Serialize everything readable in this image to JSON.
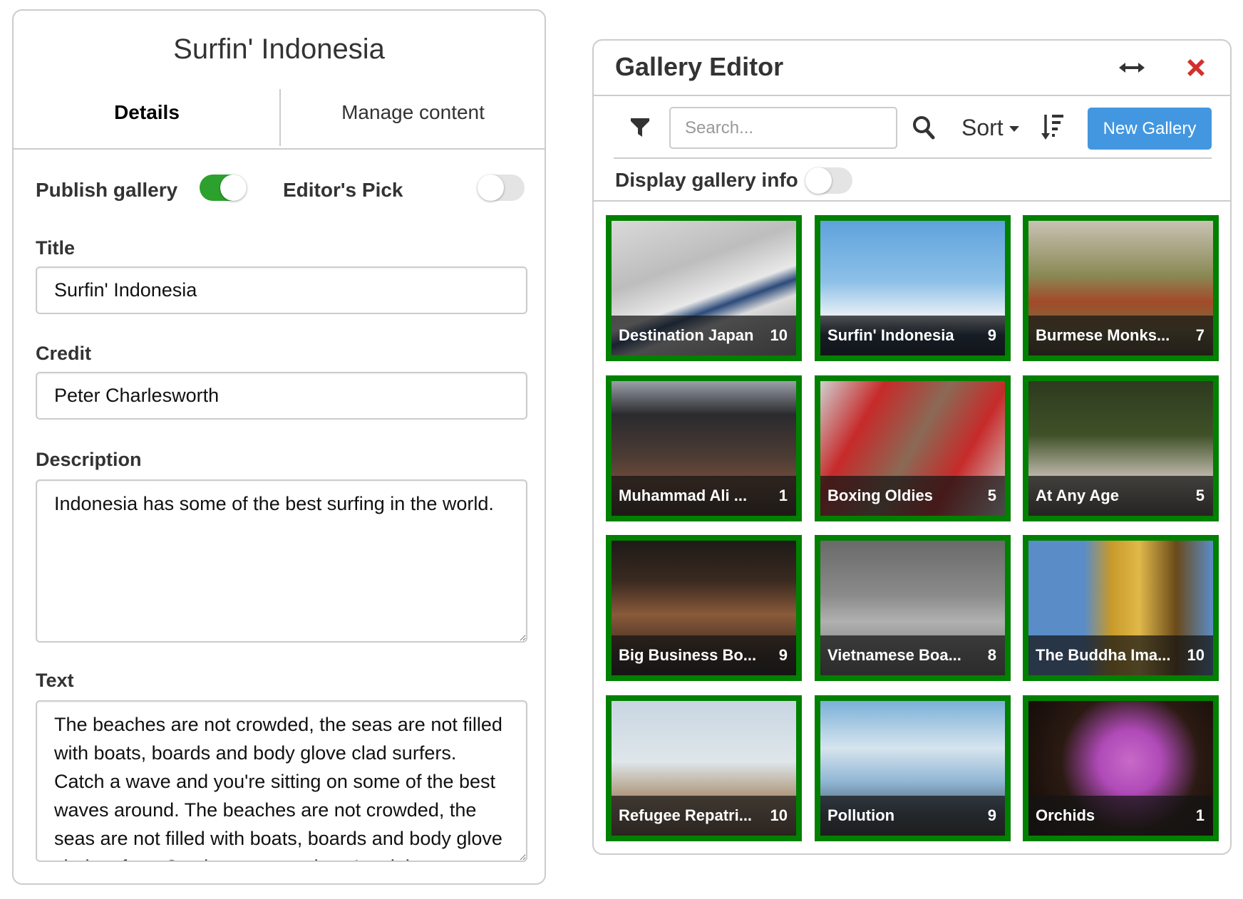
{
  "details_panel": {
    "title": "Surfin' Indonesia",
    "tabs": [
      {
        "label": "Details",
        "active": true
      },
      {
        "label": "Manage content",
        "active": false
      }
    ],
    "toggles": {
      "publish_gallery": {
        "label": "Publish gallery",
        "on": true
      },
      "editors_pick": {
        "label": "Editor's Pick",
        "on": false
      }
    },
    "fields": {
      "title": {
        "label": "Title",
        "value": "Surfin' Indonesia"
      },
      "credit": {
        "label": "Credit",
        "value": "Peter Charlesworth"
      },
      "description": {
        "label": "Description",
        "value": "Indonesia has some of the best surfing in the world."
      },
      "text": {
        "label": "Text",
        "value": "The beaches are not crowded, the seas are not filled with boats, boards and body glove clad surfers. Catch a wave and you're sitting on some of the best waves around. The beaches are not crowded, the seas are not filled with boats, boards and body glove clad surfers. Catch a wave and you're sitting on some of the best waves around."
      }
    },
    "colors": {
      "toggle_on": "#2da12d",
      "toggle_off": "#e4e4e4"
    }
  },
  "gallery_editor": {
    "title": "Gallery Editor",
    "icons": {
      "resize": "horizontal-arrows-icon",
      "close": "close-x-icon",
      "filter": "filter-funnel-icon",
      "search": "magnifier-icon",
      "sort_direction": "sort-descending-icon"
    },
    "search": {
      "placeholder": "Search...",
      "value": ""
    },
    "sort_label": "Sort",
    "new_gallery_label": "New Gallery",
    "display_info": {
      "label": "Display gallery info",
      "on": false
    },
    "colors": {
      "accent": "#4397e0",
      "close": "#d0312d",
      "tile_border": "#008000"
    },
    "galleries": [
      {
        "name": "Destination Japan",
        "count": "10",
        "image": "bullet-train"
      },
      {
        "name": "Surfin' Indonesia",
        "count": "9",
        "image": "surfer"
      },
      {
        "name": "Burmese Monks...",
        "count": "7",
        "image": "monks-football"
      },
      {
        "name": "Muhammad Ali ...",
        "count": "1",
        "image": "crowd-boxing"
      },
      {
        "name": "Boxing Oldies",
        "count": "5",
        "image": "boxing-gloves"
      },
      {
        "name": "At Any Age",
        "count": "5",
        "image": "soccer-ball"
      },
      {
        "name": "Big Business Bo...",
        "count": "9",
        "image": "boxer-phone"
      },
      {
        "name": "Vietnamese Boa...",
        "count": "8",
        "image": "girl-umbrella"
      },
      {
        "name": "The Buddha Ima...",
        "count": "10",
        "image": "golden-buddha"
      },
      {
        "name": "Refugee Repatri...",
        "count": "10",
        "image": "helicopter"
      },
      {
        "name": "Pollution",
        "count": "9",
        "image": "smokestacks"
      },
      {
        "name": "Orchids",
        "count": "1",
        "image": "orchid"
      }
    ]
  }
}
